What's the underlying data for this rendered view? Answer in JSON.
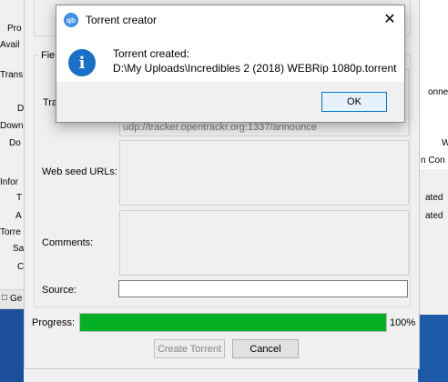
{
  "background_left": {
    "labels": [
      "Pro",
      "Avail",
      "Trans",
      "D",
      "Down",
      "Do",
      "Infor",
      "T",
      "A",
      "Torre",
      "Sa",
      "C",
      "Ge"
    ]
  },
  "background_right": {
    "labels": [
      "onne",
      "W",
      "n Con",
      "ated",
      "ated"
    ]
  },
  "creator": {
    "fields_label": "Fiel",
    "trackers_label": "Tra",
    "tracker_url": "udp://tracker.opentrackr.org:1337/announce",
    "web_seed_label": "Web seed URLs:",
    "comments_label": "Comments:",
    "source_label": "Source:",
    "source_value": "",
    "progress_label": "Progress:",
    "progress_value": 1.0,
    "progress_text": "100%",
    "create_button": "Create Torrent",
    "cancel_button": "Cancel",
    "progress_color": "#06b025"
  },
  "dialog": {
    "title": "Torrent creator",
    "app_icon": "qbittorrent-icon",
    "app_icon_text": "qb",
    "message_line1": "Torrent created:",
    "message_line2": "D:\\My Uploads\\Incredibles 2 (2018) WEBRip 1080p.torrent",
    "ok_button": "OK",
    "info_icon": "info-icon",
    "close_icon": "close-icon"
  }
}
